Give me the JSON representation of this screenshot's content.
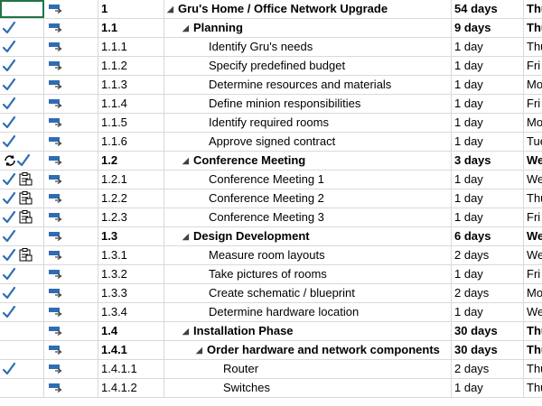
{
  "colors": {
    "check": "#2e6db4",
    "task_mode_icon": "#2e6db4",
    "grid": "#d9d9d9",
    "selection": "#217346"
  },
  "rows": [
    {
      "wbs": "1",
      "name": "Gru's Home / Office Network Upgrade",
      "duration": "54 days",
      "start": "Thu",
      "level": 0,
      "summary": true,
      "expander": true,
      "indicators": []
    },
    {
      "wbs": "1.1",
      "name": "Planning",
      "duration": "9 days",
      "start": "Thu",
      "level": 1,
      "summary": true,
      "expander": true,
      "indicators": [
        "check-icon"
      ]
    },
    {
      "wbs": "1.1.1",
      "name": "Identify Gru's needs",
      "duration": "1 day",
      "start": "Thu",
      "level": 2,
      "summary": false,
      "expander": false,
      "indicators": [
        "check-icon"
      ]
    },
    {
      "wbs": "1.1.2",
      "name": "Specify predefined budget",
      "duration": "1 day",
      "start": "Fri",
      "level": 2,
      "summary": false,
      "expander": false,
      "indicators": [
        "check-icon"
      ]
    },
    {
      "wbs": "1.1.3",
      "name": "Determine resources and materials",
      "duration": "1 day",
      "start": "Mo",
      "level": 2,
      "summary": false,
      "expander": false,
      "indicators": [
        "check-icon"
      ]
    },
    {
      "wbs": "1.1.4",
      "name": "Define minion responsibilities",
      "duration": "1 day",
      "start": "Fri",
      "level": 2,
      "summary": false,
      "expander": false,
      "indicators": [
        "check-icon"
      ]
    },
    {
      "wbs": "1.1.5",
      "name": "Identify required rooms",
      "duration": "1 day",
      "start": "Mo",
      "level": 2,
      "summary": false,
      "expander": false,
      "indicators": [
        "check-icon"
      ]
    },
    {
      "wbs": "1.1.6",
      "name": "Approve signed contract",
      "duration": "1 day",
      "start": "Tue",
      "level": 2,
      "summary": false,
      "expander": false,
      "indicators": [
        "check-icon"
      ]
    },
    {
      "wbs": "1.2",
      "name": "Conference Meeting",
      "duration": "3 days",
      "start": "We",
      "level": 1,
      "summary": true,
      "expander": true,
      "indicators": [
        "recurring-icon",
        "check-icon"
      ]
    },
    {
      "wbs": "1.2.1",
      "name": "Conference Meeting 1",
      "duration": "1 day",
      "start": "We",
      "level": 2,
      "summary": false,
      "expander": false,
      "indicators": [
        "check-icon",
        "notes-icon"
      ]
    },
    {
      "wbs": "1.2.2",
      "name": "Conference Meeting 2",
      "duration": "1 day",
      "start": "Thu",
      "level": 2,
      "summary": false,
      "expander": false,
      "indicators": [
        "check-icon",
        "notes-icon"
      ]
    },
    {
      "wbs": "1.2.3",
      "name": "Conference Meeting 3",
      "duration": "1 day",
      "start": "Fri",
      "level": 2,
      "summary": false,
      "expander": false,
      "indicators": [
        "check-icon",
        "notes-icon"
      ]
    },
    {
      "wbs": "1.3",
      "name": "Design Development",
      "duration": "6 days",
      "start": "We",
      "level": 1,
      "summary": true,
      "expander": true,
      "indicators": [
        "check-icon"
      ]
    },
    {
      "wbs": "1.3.1",
      "name": "Measure room layouts",
      "duration": "2 days",
      "start": "We",
      "level": 2,
      "summary": false,
      "expander": false,
      "indicators": [
        "check-icon",
        "notes-icon"
      ]
    },
    {
      "wbs": "1.3.2",
      "name": "Take pictures of rooms",
      "duration": "1 day",
      "start": "Fri",
      "level": 2,
      "summary": false,
      "expander": false,
      "indicators": [
        "check-icon"
      ]
    },
    {
      "wbs": "1.3.3",
      "name": "Create schematic / blueprint",
      "duration": "2 days",
      "start": "Mo",
      "level": 2,
      "summary": false,
      "expander": false,
      "indicators": [
        "check-icon"
      ]
    },
    {
      "wbs": "1.3.4",
      "name": "Determine hardware location",
      "duration": "1 day",
      "start": "We",
      "level": 2,
      "summary": false,
      "expander": false,
      "indicators": [
        "check-icon"
      ]
    },
    {
      "wbs": "1.4",
      "name": "Installation Phase",
      "duration": "30 days",
      "start": "Thu",
      "level": 1,
      "summary": true,
      "expander": true,
      "indicators": []
    },
    {
      "wbs": "1.4.1",
      "name": "Order hardware and network components",
      "duration": "30 days",
      "start": "Thu",
      "level": 2,
      "summary": true,
      "expander": true,
      "indicators": []
    },
    {
      "wbs": "1.4.1.1",
      "name": "Router",
      "duration": "2 days",
      "start": "Thu",
      "level": 3,
      "summary": false,
      "expander": false,
      "indicators": [
        "check-icon"
      ]
    },
    {
      "wbs": "1.4.1.2",
      "name": "Switches",
      "duration": "1 day",
      "start": "Thu",
      "level": 3,
      "summary": false,
      "expander": false,
      "indicators": []
    }
  ]
}
